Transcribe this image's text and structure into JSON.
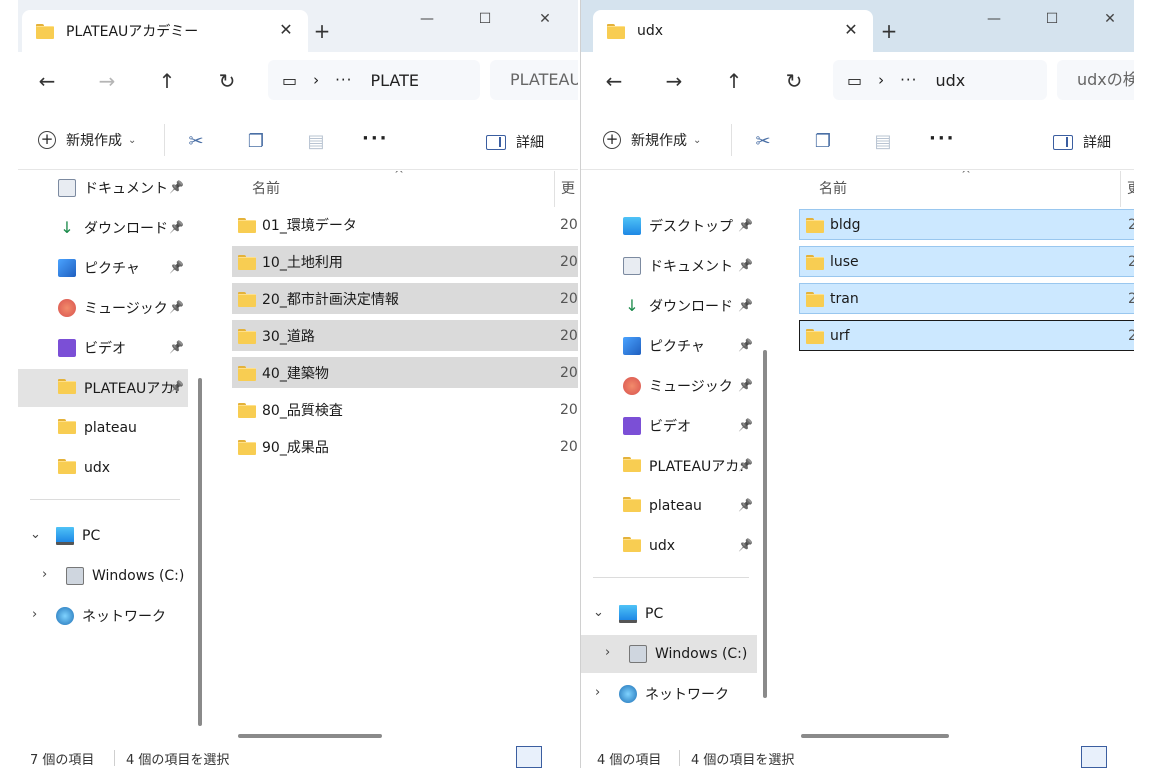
{
  "left": {
    "tab_title": "PLATEAUアカデミー",
    "new_tab_label": "+",
    "address": {
      "dots": "···",
      "crumb": "PLATE"
    },
    "search_placeholder": "PLATEAU",
    "command_bar": {
      "new_label": "新規作成",
      "details_label": "詳細",
      "more_label": "···"
    },
    "nav": {
      "quick_access": [
        {
          "label": "ドキュメント",
          "icon": "document-icon"
        },
        {
          "label": "ダウンロード",
          "icon": "download-icon"
        },
        {
          "label": "ピクチャ",
          "icon": "pictures-icon"
        },
        {
          "label": "ミュージック",
          "icon": "music-icon"
        },
        {
          "label": "ビデオ",
          "icon": "video-icon"
        },
        {
          "label": "PLATEAUアカ:",
          "icon": "folder-icon"
        },
        {
          "label": "plateau",
          "icon": "folder-icon"
        },
        {
          "label": "udx",
          "icon": "folder-icon"
        }
      ],
      "pc_label": "PC",
      "drive_label": "Windows (C:)",
      "network_label": "ネットワーク"
    },
    "columns": {
      "name": "名前",
      "date": "更"
    },
    "files": [
      {
        "name": "01_環境データ",
        "date": "20",
        "selected": false
      },
      {
        "name": "10_土地利用",
        "date": "20",
        "selected": true
      },
      {
        "name": "20_都市計画決定情報",
        "date": "20",
        "selected": true
      },
      {
        "name": "30_道路",
        "date": "20",
        "selected": true
      },
      {
        "name": "40_建築物",
        "date": "20",
        "selected": true
      },
      {
        "name": "80_品質検査",
        "date": "20",
        "selected": false
      },
      {
        "name": "90_成果品",
        "date": "20",
        "selected": false
      }
    ],
    "status": {
      "count": "7 個の項目",
      "selected": "4 個の項目を選択"
    }
  },
  "right": {
    "tab_title": "udx",
    "new_tab_label": "+",
    "address": {
      "dots": "···",
      "crumb": "udx"
    },
    "search_placeholder": "udxの検",
    "command_bar": {
      "new_label": "新規作成",
      "details_label": "詳細",
      "more_label": "···"
    },
    "nav": {
      "quick_access": [
        {
          "label": "デスクトップ",
          "icon": "desktop-icon"
        },
        {
          "label": "ドキュメント",
          "icon": "document-icon"
        },
        {
          "label": "ダウンロード",
          "icon": "download-icon"
        },
        {
          "label": "ピクチャ",
          "icon": "pictures-icon"
        },
        {
          "label": "ミュージック",
          "icon": "music-icon"
        },
        {
          "label": "ビデオ",
          "icon": "video-icon"
        },
        {
          "label": "PLATEAUアカ:",
          "icon": "folder-icon"
        },
        {
          "label": "plateau",
          "icon": "folder-icon"
        },
        {
          "label": "udx",
          "icon": "folder-icon"
        }
      ],
      "pc_label": "PC",
      "drive_label": "Windows (C:)",
      "network_label": "ネットワーク"
    },
    "columns": {
      "name": "名前",
      "date": "更"
    },
    "files": [
      {
        "name": "bldg",
        "date": "2",
        "selected": true
      },
      {
        "name": "luse",
        "date": "2",
        "selected": true
      },
      {
        "name": "tran",
        "date": "2",
        "selected": true
      },
      {
        "name": "urf",
        "date": "2",
        "selected": true
      }
    ],
    "status": {
      "count": "4 個の項目",
      "selected": "4 個の項目を選択"
    }
  },
  "window_controls": {
    "minimize": "—",
    "maximize": "☐",
    "close": "✕"
  },
  "colors": {
    "accent": "#3b5ea0",
    "selection_gray": "#dadada",
    "selection_blue": "#cce8ff",
    "folder": "#f8cd52"
  }
}
